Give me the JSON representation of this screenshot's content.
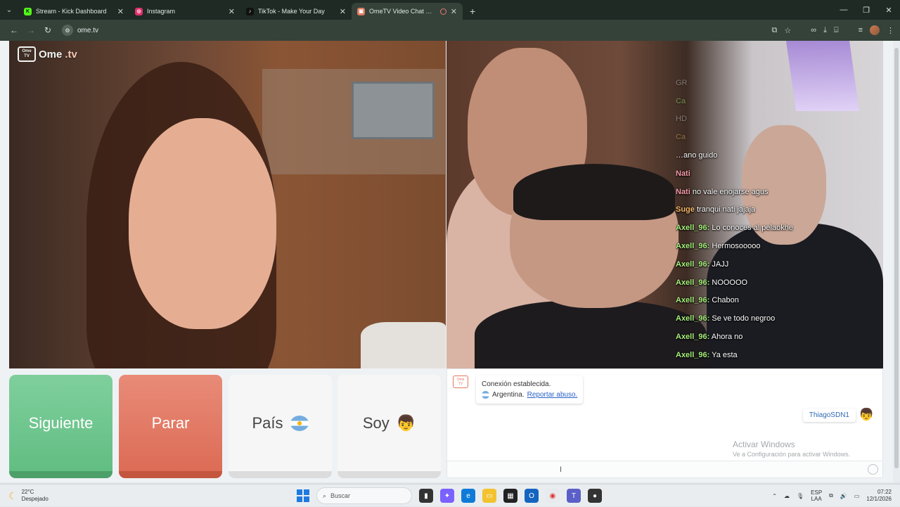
{
  "browser": {
    "tabs": [
      {
        "title": "Stream - Kick Dashboard",
        "icon": "kick-icon",
        "color": "#53fc18",
        "active": false
      },
      {
        "title": "Instagram",
        "icon": "instagram-icon",
        "color": "#e1306c",
        "active": false
      },
      {
        "title": "TikTok - Make Your Day",
        "icon": "tiktok-icon",
        "color": "#111111",
        "active": false
      },
      {
        "title": "OmeTV Video Chat — Omegle Alternative",
        "icon": "ometv-icon",
        "color": "#e07a5f",
        "active": true
      }
    ],
    "url": "ome.tv"
  },
  "page": {
    "logo": {
      "badge_top": "Ome",
      "badge_bottom": "TV",
      "name_left": "Ome",
      "name_right": ".tv"
    },
    "overlay_chat": [
      {
        "user": "",
        "text": "",
        "color": "green",
        "faded": true
      },
      {
        "user": "",
        "text": "GR",
        "color": "green",
        "faded": true
      },
      {
        "user": "Ca",
        "text": "",
        "color": "green",
        "faded": true
      },
      {
        "user": "",
        "text": "HD",
        "color": "green",
        "faded": true
      },
      {
        "user": "Ca",
        "text": "",
        "color": "orange",
        "faded": true
      },
      {
        "user": "",
        "text": "…ano guido",
        "color": "pink",
        "faded": false
      },
      {
        "user": "Nati",
        "text": "",
        "color": "pink",
        "faded": false
      },
      {
        "user": "Nati",
        "text": "no vale enojarse agus",
        "color": "pink",
        "faded": false
      },
      {
        "user": "Suge",
        "text": "tranqui nati jajaja",
        "color": "orange",
        "faded": false
      },
      {
        "user": "Axell_96:",
        "text": "Lo conoces al pelaokhe",
        "color": "green",
        "faded": false
      },
      {
        "user": "Axell_96:",
        "text": "Hermosooooo",
        "color": "green",
        "faded": false
      },
      {
        "user": "Axell_96:",
        "text": "JAJJ",
        "color": "green",
        "faded": false
      },
      {
        "user": "Axell_96:",
        "text": "NOOOOO",
        "color": "green",
        "faded": false
      },
      {
        "user": "Axell_96:",
        "text": "Chabon",
        "color": "green",
        "faded": false
      },
      {
        "user": "Axell_96:",
        "text": "Se ve todo negroo",
        "color": "green",
        "faded": false
      },
      {
        "user": "Axell_96:",
        "text": "Ahora no",
        "color": "green",
        "faded": false
      },
      {
        "user": "Axell_96:",
        "text": "Ya esta",
        "color": "green",
        "faded": false
      }
    ],
    "buttons": {
      "next": "Siguiente",
      "stop": "Parar",
      "country": "País",
      "me": "Soy"
    },
    "chat": {
      "system_status": "Conexión establecida.",
      "country": "Argentina.",
      "report_link": "Reportar abuso.",
      "my_name": "ThiagoSDN1",
      "activate_title": "Activar Windows",
      "activate_sub": "Ve a Configuración para activar Windows."
    }
  },
  "taskbar": {
    "weather_temp": "22°C",
    "weather_desc": "Despejado",
    "search_placeholder": "Buscar",
    "lang_top": "ESP",
    "lang_bottom": "LAA",
    "time": "07:22",
    "date": "12/1/2026"
  },
  "colors": {
    "next": "#62be83",
    "stop": "#dc6c56",
    "chat_user_green": "#a6f07a",
    "accent_link": "#2a62c9"
  }
}
